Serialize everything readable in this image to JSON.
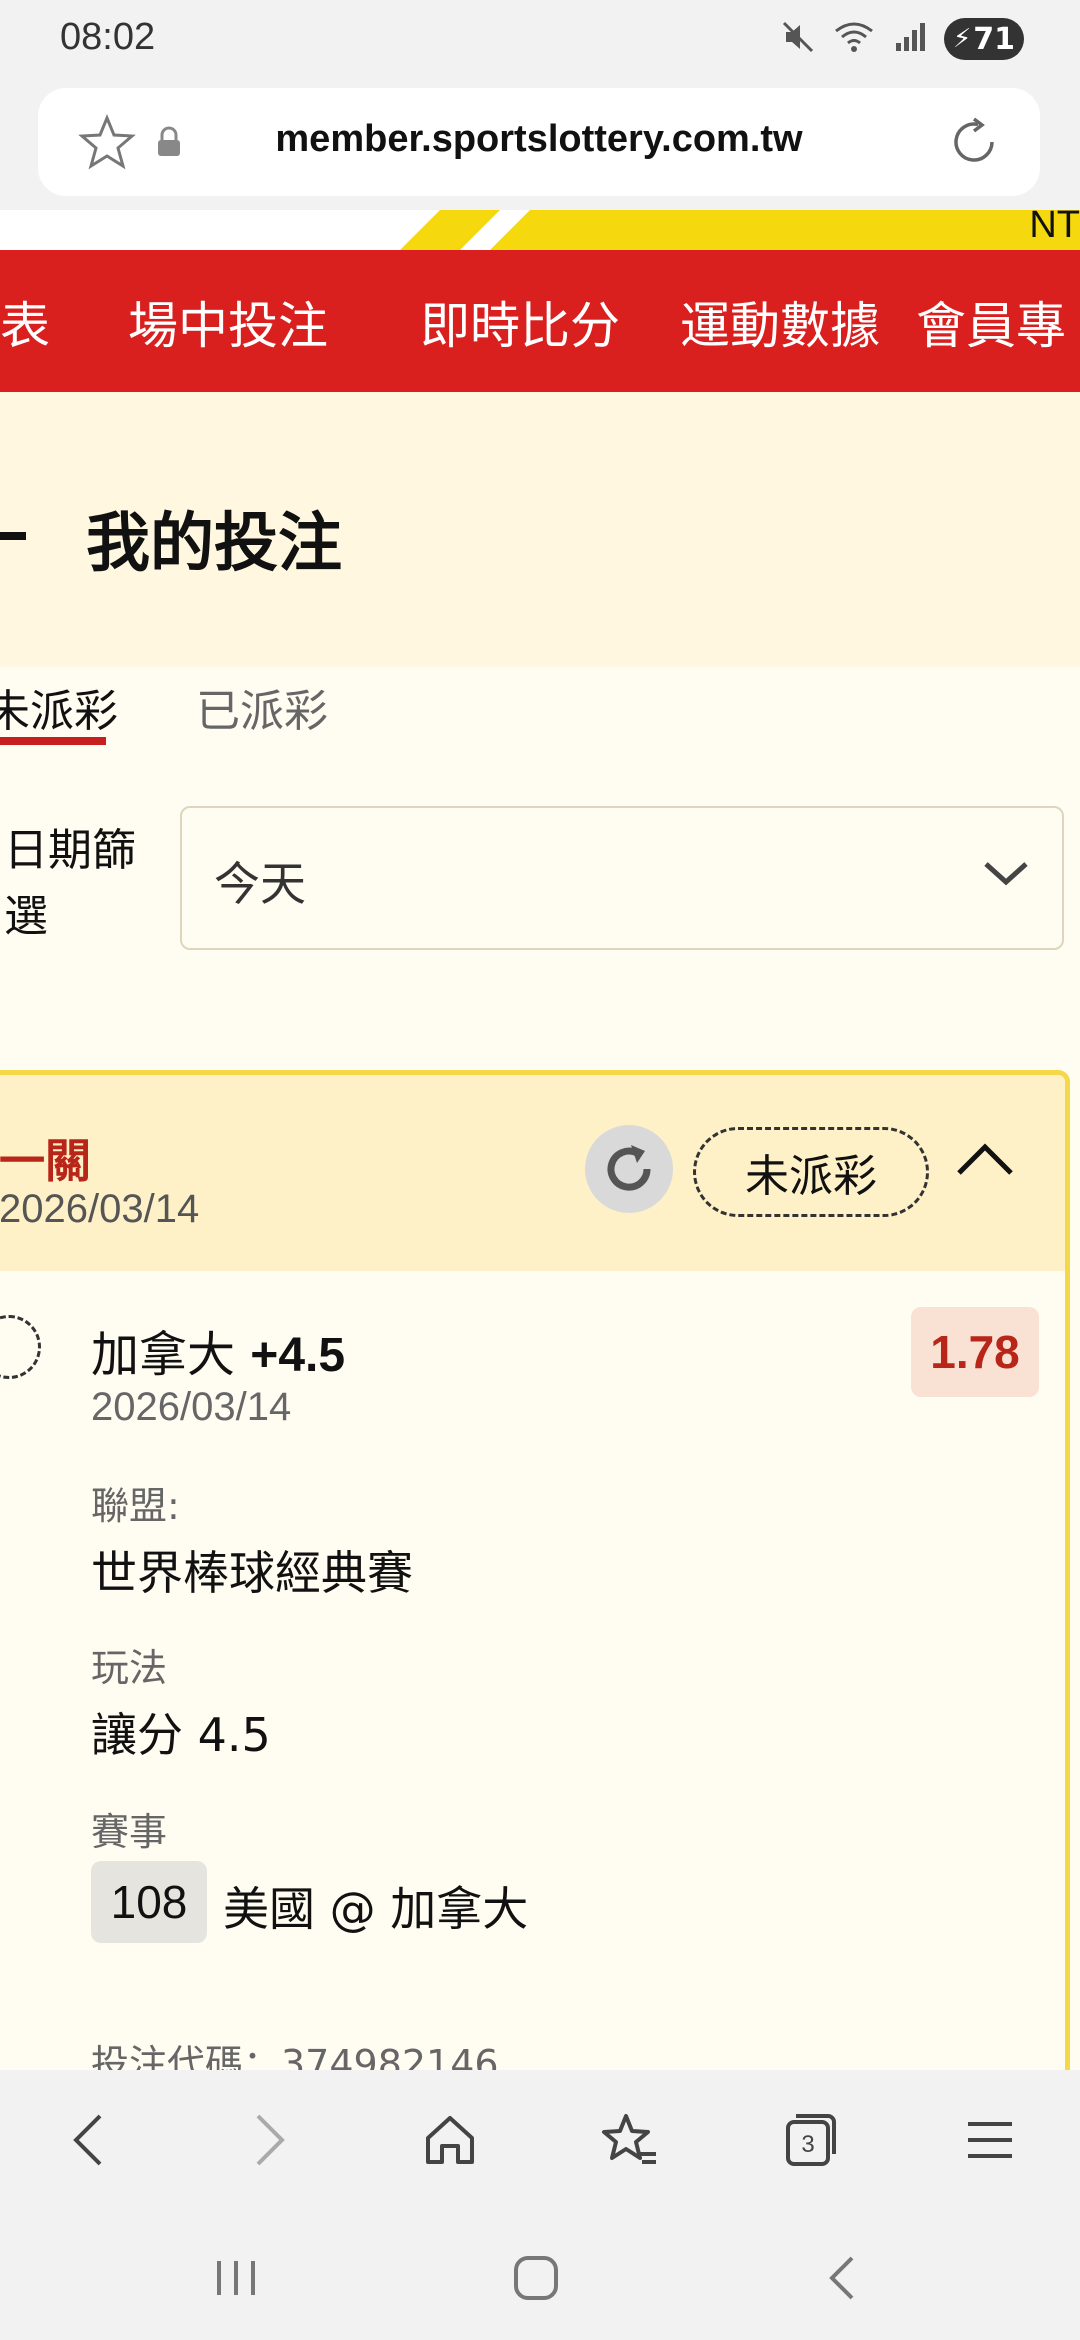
{
  "status_bar": {
    "time": "08:02",
    "battery": "71",
    "icons": [
      "mute-icon",
      "wifi-icon",
      "signal-icon",
      "battery-icon"
    ]
  },
  "browser": {
    "url": "member.sportslottery.com.tw",
    "tab_count": "3"
  },
  "banner": {
    "partial_text": "NT"
  },
  "nav": {
    "items": [
      {
        "label": "表"
      },
      {
        "label": "場中投注"
      },
      {
        "label": "即時比分"
      },
      {
        "label": "運動數據"
      },
      {
        "label": "會員專"
      }
    ]
  },
  "page": {
    "title": "我的投注"
  },
  "tabs": {
    "active": "未派彩",
    "other": "已派彩"
  },
  "filter": {
    "label": "日期篩選",
    "value": "今天"
  },
  "bet": {
    "type": "一關",
    "date": "2026/03/14",
    "status": "未派彩",
    "selection_team": "加拿大",
    "selection_line": "+4.5",
    "odds": "1.78",
    "selection_date": "2026/03/14",
    "league_label": "聯盟:",
    "league": "世界棒球經典賽",
    "market_label": "玩法",
    "market": "讓分 4.5",
    "event_label": "賽事",
    "event_code": "108",
    "event_name": "美國 @ 加拿大",
    "bet_code_partial": "投注代碼：374982146"
  },
  "colors": {
    "brand_red": "#d9201f",
    "brand_yellow": "#f5d90e",
    "odds_red": "#b8261a"
  }
}
